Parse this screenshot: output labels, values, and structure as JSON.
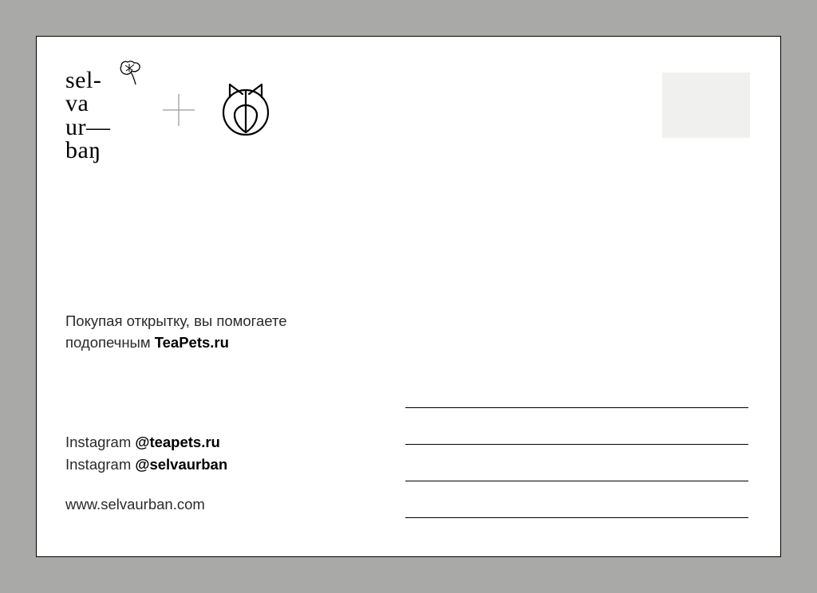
{
  "logo": {
    "line1": "sel-",
    "line2": "va",
    "line3": "ur—",
    "line4": "baŋ"
  },
  "message": {
    "line1": "Покупая открытку, вы помогаете",
    "line2_prefix": "подопечным ",
    "line2_bold": "TeaPets.ru"
  },
  "socials": {
    "instagram_label": "Instagram ",
    "handle1": "@teapets.ru",
    "handle2": "@selvaurban"
  },
  "website": "www.selvaurban.com"
}
